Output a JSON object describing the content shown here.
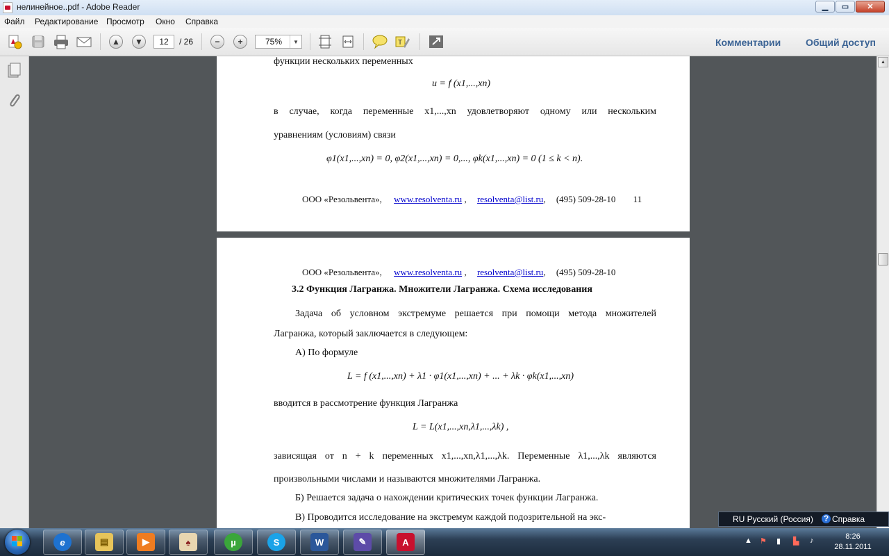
{
  "window": {
    "title": "нелинейное..pdf - Adobe Reader"
  },
  "menu": [
    "Файл",
    "Редактирование",
    "Просмотр",
    "Окно",
    "Справка"
  ],
  "toolbar": {
    "current_page": "12",
    "total_pages": "/ 26",
    "zoom": "75%",
    "comments_label": "Комментарии",
    "share_label": "Общий доступ"
  },
  "page1": {
    "line1": "функции нескольких переменных",
    "formula1": "u = f (x1,...,xn)",
    "line2": "в случае, когда переменные x1,...,xn удовлетворяют одному или нескольким",
    "line3": "уравнениям (условиям) связи",
    "formula2": "φ1(x1,...,xn) = 0, φ2(x1,...,xn) = 0,..., φk(x1,...,xn) = 0   (1 ≤ k < n).",
    "footer_company": "ООО «Резольвента»,",
    "footer_site": "www.resolventa.ru",
    "footer_email": "resolventa@list.ru",
    "footer_phone": "(495) 509-28-10",
    "page_number": "11"
  },
  "page2": {
    "header_company": "ООО «Резольвента»,",
    "header_site": "www.resolventa.ru",
    "header_email": "resolventa@list.ru",
    "header_phone": "(495) 509-28-10",
    "heading": "3.2 Функция Лагранжа. Множители Лагранжа. Схема исследования",
    "p1_line1": "Задача об условном экстремуме решается при помощи метода множителей",
    "p1_line2": "Лагранжа, который заключается в следующем:",
    "a_line": "А)  По формуле",
    "formula_L": "L = f (x1,...,xn) + λ1 · φ1(x1,...,xn) + ... + λk · φk(x1,...,xn)",
    "intro_line": "вводится в рассмотрение функция Лагранжа",
    "formula_L2": "L = L(x1,...,xn,λ1,...,λk) ,",
    "dep_line": "зависящая от n + k  переменных x1,...,xn,λ1,...,λk. Переменные λ1,...,λk являются",
    "arb_line": "произвольными числами и называются множителями Лагранжа.",
    "b_line": "Б)  Решается задача о нахождении критических точек функции Лагранжа.",
    "c_line": "В) Проводится исследование на экстремум каждой подозрительной на экс-"
  },
  "langbar": {
    "language": "RU Русский (Россия)",
    "help": "Справка"
  },
  "clock": {
    "time": "8:26",
    "date": "28.11.2011"
  },
  "colors": {
    "accent": "#3c6495",
    "link": "#0000cc",
    "doc_background": "#525659"
  }
}
